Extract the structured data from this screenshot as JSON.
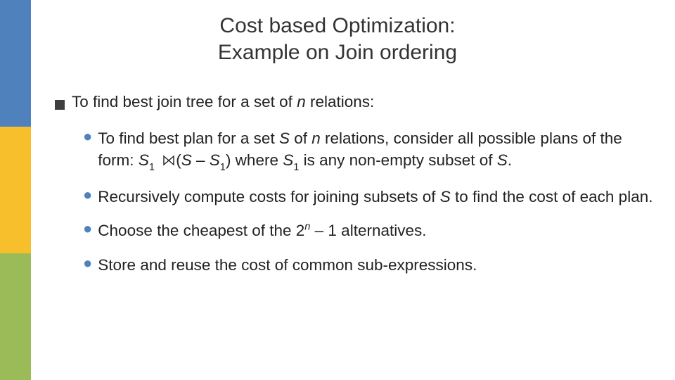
{
  "title": {
    "line1": "Cost based Optimization:",
    "line2": "Example on Join ordering"
  },
  "lvl1": {
    "prefix": "To find best join tree for a set of ",
    "n": "n",
    "suffix": " relations:"
  },
  "b1": {
    "t0": "To find best plan for a set ",
    "S": "S",
    "t1": " of ",
    "n": "n",
    "t2": " relations, consider all possible plans of the form:  ",
    "S1a": "S",
    "sub1a": "1",
    "join_glyph": "⋈",
    "open": "(",
    "S2": "S",
    "minus": " – ",
    "S1b": "S",
    "sub1b": "1",
    "close": ") where ",
    "S1c": "S",
    "sub1c": "1",
    "t3": " is any non-empty subset of ",
    "Send": "S",
    "dot": "."
  },
  "b2": {
    "t0": "Recursively compute costs for joining subsets of ",
    "S": "S",
    "t1": " to find the cost of each plan."
  },
  "b3": {
    "t0": "Choose the cheapest of the 2",
    "exp": "n",
    "t1": " – 1 alternatives."
  },
  "b4": {
    "t0": "Store and reuse the cost of common sub-expressions."
  }
}
